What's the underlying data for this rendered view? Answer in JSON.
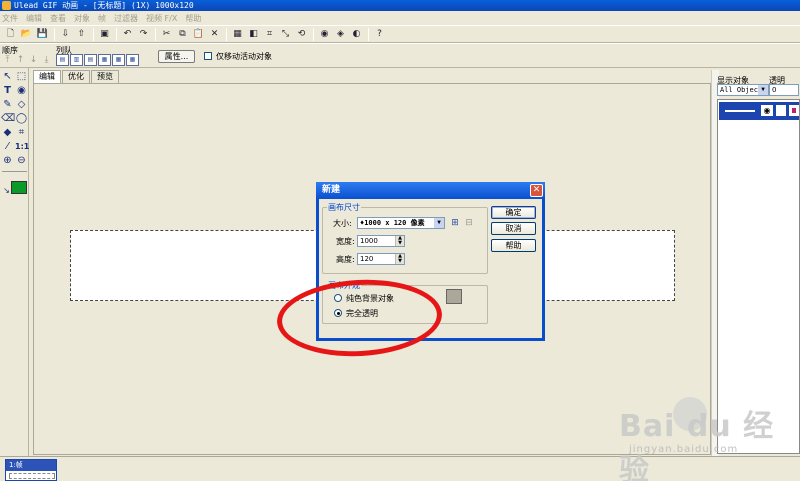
{
  "window": {
    "title": "Ulead GIF 动画 - [无标题] (1X) 1000x120"
  },
  "menu": [
    "文件",
    "编辑",
    "查看",
    "对象",
    "帧",
    "过滤器",
    "视频 F/X",
    "帮助"
  ],
  "toolbar2": {
    "order_label": "顺序",
    "align_label": "列队",
    "properties_label": "属性...",
    "only_moving_label": "仅移动活动对象"
  },
  "tabs": [
    "编辑",
    "优化",
    "预览"
  ],
  "right_panel": {
    "show_objects_label": "显示对象",
    "transparency_label": "透明",
    "object_select_value": "All Object",
    "transparency_value": "0"
  },
  "frames": [
    {
      "label": "1:帧"
    }
  ],
  "dialog": {
    "title": "新建",
    "close_glyph": "✕",
    "group_size": "画布尺寸",
    "size_label": "大小:",
    "size_value": "♦1000 x 120 像素",
    "width_label": "宽度:",
    "width_value": "1000",
    "height_label": "高度:",
    "height_value": "120",
    "group_appearance": "画布外观",
    "option_solid": "纯色背景对象",
    "option_transparent": "完全透明",
    "selected_option": "transparent",
    "ok_label": "确定",
    "cancel_label": "取消",
    "help_label": "帮助"
  },
  "watermark": {
    "brand": "Bai du 经验",
    "url": "jingyan.baidu.com"
  },
  "colors": {
    "foreground_swatch": "#0a9a2a",
    "annotation": "#e61616",
    "title_blue": "#0a50d0"
  }
}
